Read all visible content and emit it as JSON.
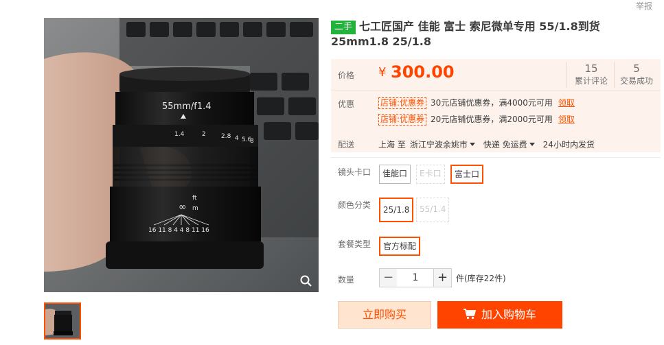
{
  "header": {
    "report_link": "举报"
  },
  "product": {
    "badge": "二手",
    "title": "七工匠国产 佳能 富士 索尼微单专用 55/1.8到货 25mm1.8 25/1.8"
  },
  "image": {
    "lens_text": "55mm/f1.4",
    "aperture_scale": [
      "1.4",
      "2",
      "2.8",
      "4",
      "5.6",
      "8"
    ],
    "distance_ft": "ft",
    "distance_m": "m",
    "dof_scale": "16 11 8 4 4 8 11 16"
  },
  "price": {
    "label": "价格",
    "currency": "¥",
    "value": "300.00",
    "reviews_count": "15",
    "reviews_label": "累计评论",
    "deals_count": "5",
    "deals_label": "交易成功"
  },
  "promo": {
    "label": "优惠",
    "items": [
      {
        "tag": "店铺:优惠券",
        "text": "30元店铺优惠券，满4000元可用",
        "link": "领取"
      },
      {
        "tag": "店铺:优惠券",
        "text": "20元店铺优惠券，满2000元可用",
        "link": "领取"
      }
    ]
  },
  "delivery": {
    "label": "配送",
    "from": "上海 至",
    "to": "浙江宁波余姚市",
    "method": "快递 免运费",
    "ship_time": "24小时内发货"
  },
  "sku": {
    "mount": {
      "label": "镜头卡口",
      "options": [
        "佳能口",
        "E卡口",
        "富士口"
      ],
      "selected": "富士口"
    },
    "color": {
      "label": "颜色分类",
      "options": [
        "25/1.8",
        "55/1.4"
      ],
      "selected": "25/1.8"
    },
    "package": {
      "label": "套餐类型",
      "options": [
        "官方标配"
      ],
      "selected": "官方标配"
    }
  },
  "quantity": {
    "label": "数量",
    "minus": "−",
    "value": "1",
    "plus": "+",
    "stock": "件(库存22件)"
  },
  "actions": {
    "buy_now": "立即购买",
    "add_to_cart": "加入购物车"
  },
  "colors": {
    "accent": "#ff5000",
    "price_bg": "#fdf3ec",
    "used_badge": "#21b33b"
  }
}
